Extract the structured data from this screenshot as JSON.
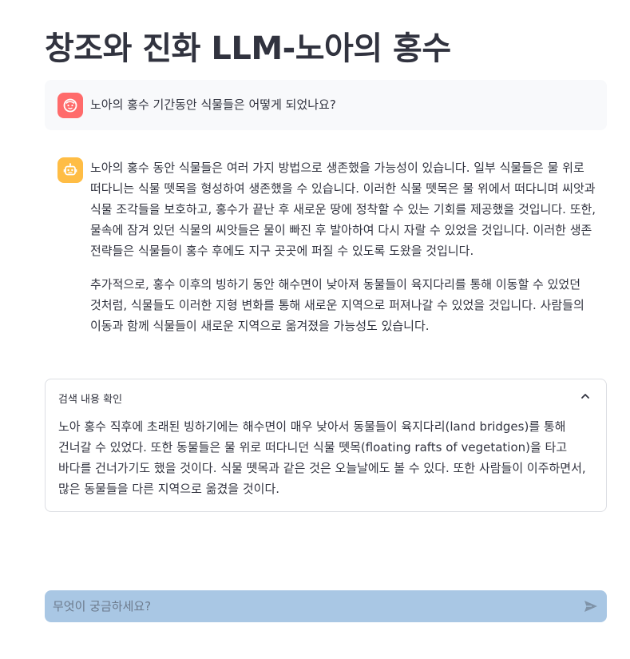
{
  "page": {
    "title": "창조와 진화 LLM-노아의 홍수"
  },
  "chat": {
    "user_message": "노아의 홍수 기간동안 식물들은 어떻게 되었나요?",
    "user_avatar_icon": "face-icon",
    "bot_avatar_icon": "robot-icon",
    "bot_paragraphs": [
      "노아의 홍수 동안 식물들은 여러 가지 방법으로 생존했을 가능성이 있습니다. 일부 식물들은 물 위로 떠다니는 식물 뗏목을 형성하여 생존했을 수 있습니다. 이러한 식물 뗏목은 물 위에서 떠다니며 씨앗과 식물 조각들을 보호하고, 홍수가 끝난 후 새로운 땅에 정착할 수 있는 기회를 제공했을 것입니다. 또한, 물속에 잠겨 있던 식물의 씨앗들은 물이 빠진 후 발아하여 다시 자랄 수 있었을 것입니다. 이러한 생존 전략들은 식물들이 홍수 후에도 지구 곳곳에 퍼질 수 있도록 도왔을 것입니다.",
      "추가적으로, 홍수 이후의 빙하기 동안 해수면이 낮아져 동물들이 육지다리를 통해 이동할 수 있었던 것처럼, 식물들도 이러한 지형 변화를 통해 새로운 지역으로 퍼져나갈 수 있었을 것입니다. 사람들의 이동과 함께 식물들이 새로운 지역으로 옮겨졌을 가능성도 있습니다."
    ]
  },
  "expander": {
    "title": "검색 내용 확인",
    "body": "노아 홍수 직후에 초래된 빙하기에는 해수면이 매우 낮아서 동물들이 육지다리(land bridges)를 통해 건너갈 수 있었다. 또한 동물들은 물 위로 떠다니던 식물 뗏목(floating rafts of vegetation)을 타고 바다를 건너가기도 했을 것이다. 식물 뗏목과 같은 것은 오늘날에도 볼 수 있다. 또한 사람들이 이주하면서, 많은 동물들을 다른 지역으로 옮겼을 것이다."
  },
  "input": {
    "placeholder": "무엇이 궁금하세요?",
    "value": ""
  },
  "colors": {
    "user_avatar_bg": "#ff6b6b",
    "bot_avatar_bg": "#ffbd45",
    "user_message_bg": "#f8f9fb",
    "input_bg": "#a9c7e4",
    "text": "#31333f"
  }
}
